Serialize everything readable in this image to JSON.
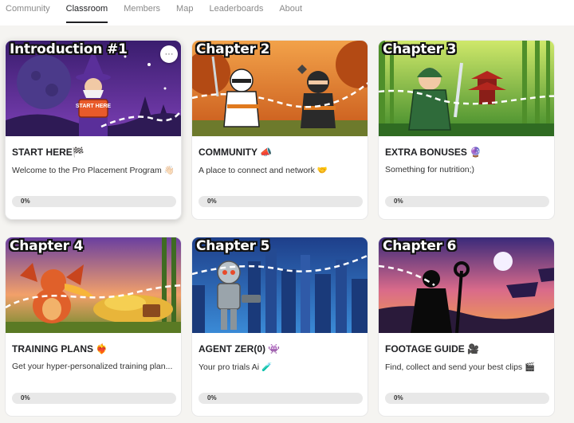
{
  "nav": {
    "tabs": [
      {
        "label": "Community",
        "active": false
      },
      {
        "label": "Classroom",
        "active": true
      },
      {
        "label": "Members",
        "active": false
      },
      {
        "label": "Map",
        "active": false
      },
      {
        "label": "Leaderboards",
        "active": false
      },
      {
        "label": "About",
        "active": false
      }
    ]
  },
  "courses": [
    {
      "chapter_label": "Introduction #1",
      "title": "START HERE🏁",
      "description": "Welcome to the Pro Placement Program 👋🏻",
      "progress_text": "0%",
      "progress": 0,
      "image": "wizard-start-here",
      "more_button": "···"
    },
    {
      "chapter_label": "Chapter 2",
      "title": "COMMUNITY 📣",
      "description": "A place to connect and network 🤝",
      "progress_text": "0%",
      "progress": 0,
      "image": "ninjas"
    },
    {
      "chapter_label": "Chapter 3",
      "title": "EXTRA BONUSES 🔮",
      "description": "Something for nutrition;)",
      "progress_text": "0%",
      "progress": 0,
      "image": "green-samurai"
    },
    {
      "chapter_label": "Chapter 4",
      "title": "TRAINING PLANS ❤️‍🔥",
      "description": "Get your hyper-personalized training plan...",
      "progress_text": "0%",
      "progress": 0,
      "image": "dragon-treasure"
    },
    {
      "chapter_label": "Chapter 5",
      "title": "AGENT ZER(0) 👾",
      "description": "Your pro trials Ai 🧪",
      "progress_text": "0%",
      "progress": 0,
      "image": "robot-city"
    },
    {
      "chapter_label": "Chapter 6",
      "title": "FOOTAGE GUIDE 🎥",
      "description": "Find, collect and send your best clips 🎬",
      "progress_text": "0%",
      "progress": 0,
      "image": "silhouette-sunset"
    }
  ],
  "thumbnail_text": {
    "start_here_sign": "START HERE"
  },
  "colors": {
    "page_bg": "#f5f4f1",
    "card_bg": "#ffffff",
    "progress_track": "#e8e8e8",
    "active_tab": "#202124",
    "inactive_tab": "#8a8a8a"
  }
}
